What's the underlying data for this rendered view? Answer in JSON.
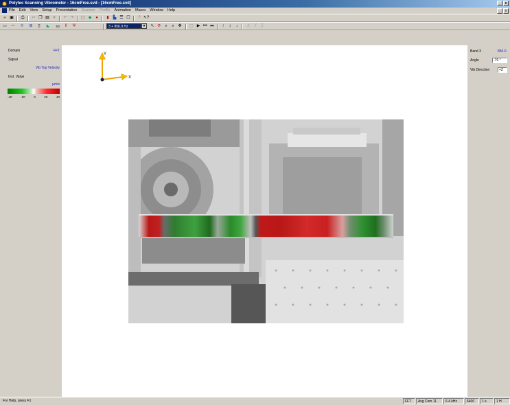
{
  "window": {
    "title": "Polytec Scanning Vibrometer - 16cmFree.svd - [16cmFree.svd]",
    "minimize": "_",
    "close": "x"
  },
  "menu": {
    "items": [
      "File",
      "Edit",
      "View",
      "Setup",
      "Presentation",
      "Scanner",
      "Profile",
      "Animation",
      "Macro",
      "Window",
      "Help"
    ],
    "disabled": [
      "Scanner",
      "Profile"
    ]
  },
  "toolbar": {
    "frequency_value": "3 + 856.0 Hz",
    "view_3d_label": "3D",
    "axis_labels": [
      "X",
      "Y",
      "Z"
    ]
  },
  "left_panel": {
    "domain_label": "Domain",
    "domain_value": "FFT",
    "signal_label": "Signal",
    "signal_value": "Vib Top Velocity",
    "value_label": "Inst. Value",
    "unit": "µm/s",
    "scale_ticks": [
      "-40",
      "-20",
      "0",
      "20",
      "40"
    ]
  },
  "canvas": {
    "axis_y": "Y",
    "axis_x": "X"
  },
  "right_panel": {
    "band_label": "Band 3",
    "band_value": "856.0",
    "angle_label": "Angle",
    "angle_value": "-70 °",
    "vib_direction_label": "Vib Direction",
    "vib_direction_value": "+Z"
  },
  "status": {
    "help": "For Help, press F1",
    "mode": "FFT",
    "avg": "Avg Com 11",
    "bandwidth": "6.4 kHz",
    "lines": "6400",
    "time": "1 s",
    "extra": "1 H"
  },
  "colors": {
    "titlebar": "#0a246a",
    "accent_blue": "#2020c0",
    "negative": "#22c422",
    "positive": "#ff2a2a"
  }
}
